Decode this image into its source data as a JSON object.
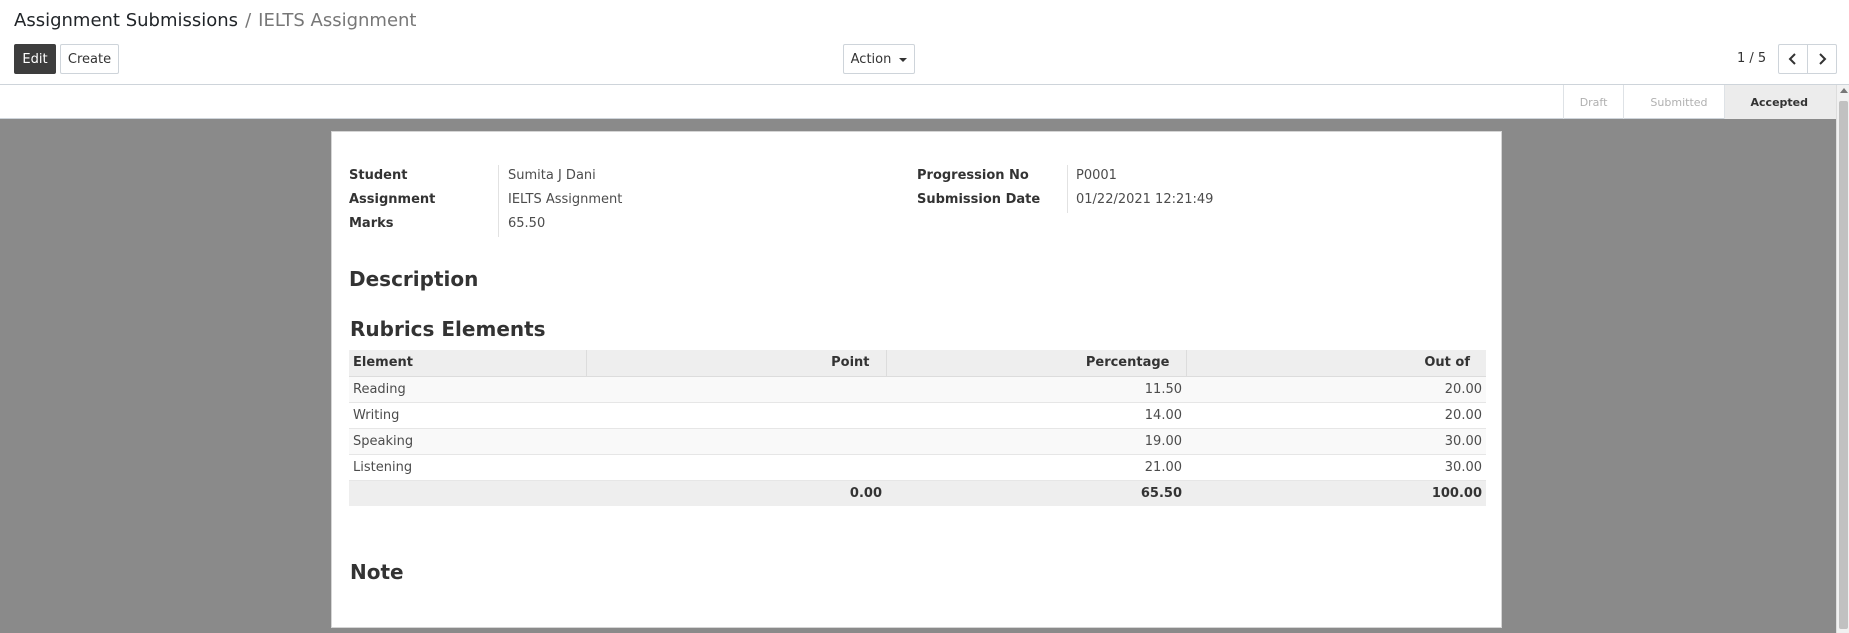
{
  "breadcrumb": {
    "parent": "Assignment Submissions",
    "separator": "/",
    "current": "IELTS Assignment"
  },
  "toolbar": {
    "edit_label": "Edit",
    "create_label": "Create",
    "action_label": "Action"
  },
  "pager": {
    "value": "1 / 5"
  },
  "statusbar": {
    "steps": [
      "Draft",
      "Submitted",
      "Accepted"
    ],
    "active": "Accepted"
  },
  "form": {
    "student_label": "Student",
    "student_value": "Sumita J Dani",
    "assignment_label": "Assignment",
    "assignment_value": "IELTS Assignment",
    "marks_label": "Marks",
    "marks_value": "65.50",
    "progression_label": "Progression No",
    "progression_value": "P0001",
    "submission_date_label": "Submission Date",
    "submission_date_value": "01/22/2021 12:21:49"
  },
  "sections": {
    "description": "Description",
    "rubrics": "Rubrics Elements",
    "note": "Note"
  },
  "rubrics_table": {
    "headers": [
      "Element",
      "Point",
      "Percentage",
      "Out of"
    ],
    "rows": [
      {
        "element": "Reading",
        "point": "",
        "percentage": "11.50",
        "out_of": "20.00"
      },
      {
        "element": "Writing",
        "point": "",
        "percentage": "14.00",
        "out_of": "20.00"
      },
      {
        "element": "Speaking",
        "point": "",
        "percentage": "19.00",
        "out_of": "30.00"
      },
      {
        "element": "Listening",
        "point": "",
        "percentage": "21.00",
        "out_of": "30.00"
      }
    ],
    "totals": {
      "point": "0.00",
      "percentage": "65.50",
      "out_of": "100.00"
    }
  }
}
